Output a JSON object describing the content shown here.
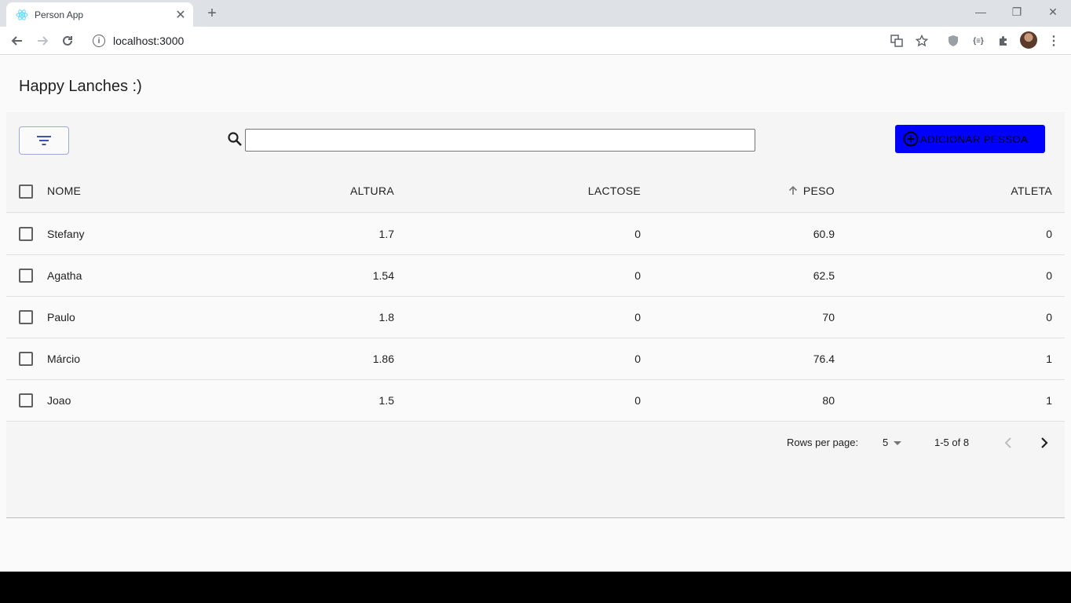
{
  "browser": {
    "tab_title": "Person App",
    "url": "localhost:3000",
    "new_tab": "+",
    "close_tab": "✕",
    "win_minimize": "—",
    "win_restore": "❐",
    "win_close": "✕"
  },
  "app": {
    "title": "Happy Lanches :)",
    "search": {
      "value": "",
      "placeholder": ""
    },
    "add_button_label": "ADICIONAR PESSOA"
  },
  "table": {
    "columns": {
      "nome": "NOME",
      "altura": "ALTURA",
      "lactose": "LACTOSE",
      "peso": "PESO",
      "atleta": "ATLETA"
    },
    "sorted_by": "peso",
    "sort_direction": "asc",
    "rows": [
      {
        "nome": "Stefany",
        "altura": "1.7",
        "lactose": "0",
        "peso": "60.9",
        "atleta": "0"
      },
      {
        "nome": "Agatha",
        "altura": "1.54",
        "lactose": "0",
        "peso": "62.5",
        "atleta": "0"
      },
      {
        "nome": "Paulo",
        "altura": "1.8",
        "lactose": "0",
        "peso": "70",
        "atleta": "0"
      },
      {
        "nome": "Márcio",
        "altura": "1.86",
        "lactose": "0",
        "peso": "76.4",
        "atleta": "1"
      },
      {
        "nome": "Joao",
        "altura": "1.5",
        "lactose": "0",
        "peso": "80",
        "atleta": "1"
      }
    ]
  },
  "pagination": {
    "rows_per_page_label": "Rows per page:",
    "rows_per_page_value": "5",
    "range_label": "1-5 of 8"
  },
  "colors": {
    "add_button": "#0000ff",
    "page_bg": "#fafafa",
    "tab_strip": "#dee1e6"
  }
}
